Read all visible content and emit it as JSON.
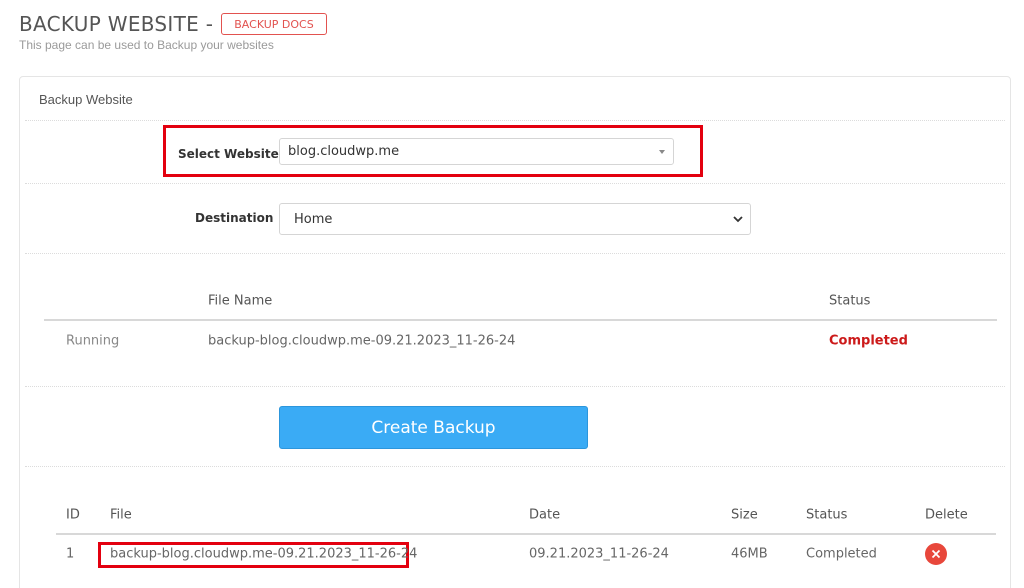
{
  "header": {
    "title": "BACKUP WEBSITE -",
    "docs_label": "BACKUP DOCS",
    "subtitle": "This page can be used to Backup your websites"
  },
  "panel": {
    "heading": "Backup Website"
  },
  "form": {
    "website_label": "Select Website",
    "website_value": "blog.cloudwp.me",
    "destination_label": "Destination",
    "destination_value": "Home"
  },
  "running_table": {
    "headers": [
      "",
      "File Name",
      "Status"
    ],
    "row": {
      "state": "Running",
      "file": "backup-blog.cloudwp.me-09.21.2023_11-26-24",
      "status": "Completed"
    }
  },
  "create_button_label": "Create Backup",
  "backups_table": {
    "headers": [
      "ID",
      "File",
      "Date",
      "Size",
      "Status",
      "Delete"
    ],
    "rows": [
      {
        "id": "1",
        "file": "backup-blog.cloudwp.me-09.21.2023_11-26-24",
        "date": "09.21.2023_11-26-24",
        "size": "46MB",
        "status": "Completed"
      }
    ]
  },
  "colors": {
    "accent": "#3aabf5",
    "danger": "#e3000f",
    "status_completed": "#cc1a1a",
    "delete": "#e8473b"
  },
  "icons": {
    "select_caret": "caret-down-icon",
    "destination_chevron": "chevron-down-icon",
    "delete": "close-icon"
  }
}
